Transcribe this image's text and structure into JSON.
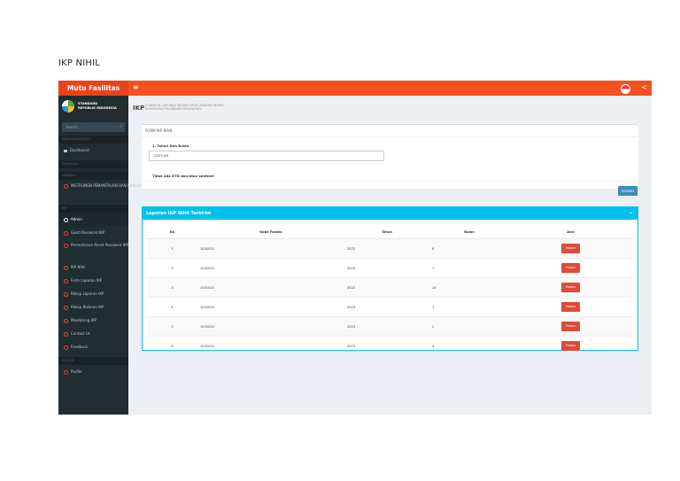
{
  "page_heading": "IKP NIHIL",
  "topbar": {
    "brand": "Mutu Fasilitas",
    "hamburger_icon": "≡",
    "share_icon": "<"
  },
  "sidebar": {
    "logo_line1": "STANDARD",
    "logo_line2": "REPUBLIK INDONESIA",
    "search_placeholder": "Search...",
    "sections": [
      {
        "header": "MAIN NAVIGATION",
        "items": [
          {
            "label": "Dashboard",
            "icon": "dashboard-icon"
          }
        ]
      },
      {
        "header": "Puskesmas",
        "items": []
      },
      {
        "header": "Indikator",
        "items": [
          {
            "label": "INSTRUMEN PEMANTAUAN DAN EVALUASI",
            "icon": "circle-icon",
            "two_line": true
          }
        ]
      },
      {
        "header": "IKP",
        "items": [
          {
            "label": "Admin",
            "icon": "circle-icon",
            "active": true
          },
          {
            "label": "Ganti Password IKP",
            "icon": "circle-icon"
          },
          {
            "label": "Permohonan Reset Password IKP",
            "icon": "circle-icon",
            "two_line": true
          },
          {
            "label": "IKP Nihil",
            "icon": "circle-icon"
          },
          {
            "label": "Form Laporan IKP",
            "icon": "circle-icon"
          },
          {
            "label": "Rekap Laporan IKP",
            "icon": "circle-icon"
          },
          {
            "label": "Rekap Bulanan IKP",
            "icon": "circle-icon"
          },
          {
            "label": "Monitoring IKP",
            "icon": "circle-icon"
          },
          {
            "label": "Contact Us",
            "icon": "circle-icon"
          },
          {
            "label": "Feedback",
            "icon": "circle-icon"
          }
        ]
      },
      {
        "header": "KELUAR",
        "items": [
          {
            "label": "Profile",
            "icon": "circle-icon"
          }
        ]
      }
    ]
  },
  "content_header": {
    "title": "IKP",
    "subtitle_line1": "FORMULIR LAPORAN INSIDEN KESELAMATAN PASIEN",
    "subtitle_line2": "DI FASILITAS PELAYANAN KESEHATAN"
  },
  "form": {
    "title": "FORM IKP NIHIL",
    "field_label": "1. Tahun Dan Bulan",
    "field_value": "2023-09",
    "note": "Tidak ada KTD dan/atau sentinel",
    "save_label": "SIMPAN"
  },
  "report": {
    "title": "Laporan IKP Nihil Terkirim",
    "minimize_icon": "−",
    "columns": [
      "No",
      "Kode Faskes",
      "Tahun",
      "Bulan",
      "Aksi"
    ],
    "rows": [
      {
        "no": "1",
        "kode": "1031022",
        "tahun": "2022",
        "bulan": "6",
        "aksi": "Hapus"
      },
      {
        "no": "2",
        "kode": "1031022",
        "tahun": "2022",
        "bulan": "7",
        "aksi": "Hapus"
      },
      {
        "no": "3",
        "kode": "1031022",
        "tahun": "2022",
        "bulan": "10",
        "aksi": "Hapus"
      },
      {
        "no": "4",
        "kode": "1031022",
        "tahun": "2023",
        "bulan": "1",
        "aksi": "Hapus"
      },
      {
        "no": "5",
        "kode": "1031022",
        "tahun": "2023",
        "bulan": "2",
        "aksi": "Hapus"
      },
      {
        "no": "6",
        "kode": "1031022",
        "tahun": "2023",
        "bulan": "4",
        "aksi": "Hapus"
      }
    ]
  },
  "colors": {
    "topbar": "#f4511e",
    "sidebar": "#222d32",
    "accent": "#00c0ef",
    "danger": "#dd4b39",
    "primary": "#3c8dbc"
  }
}
